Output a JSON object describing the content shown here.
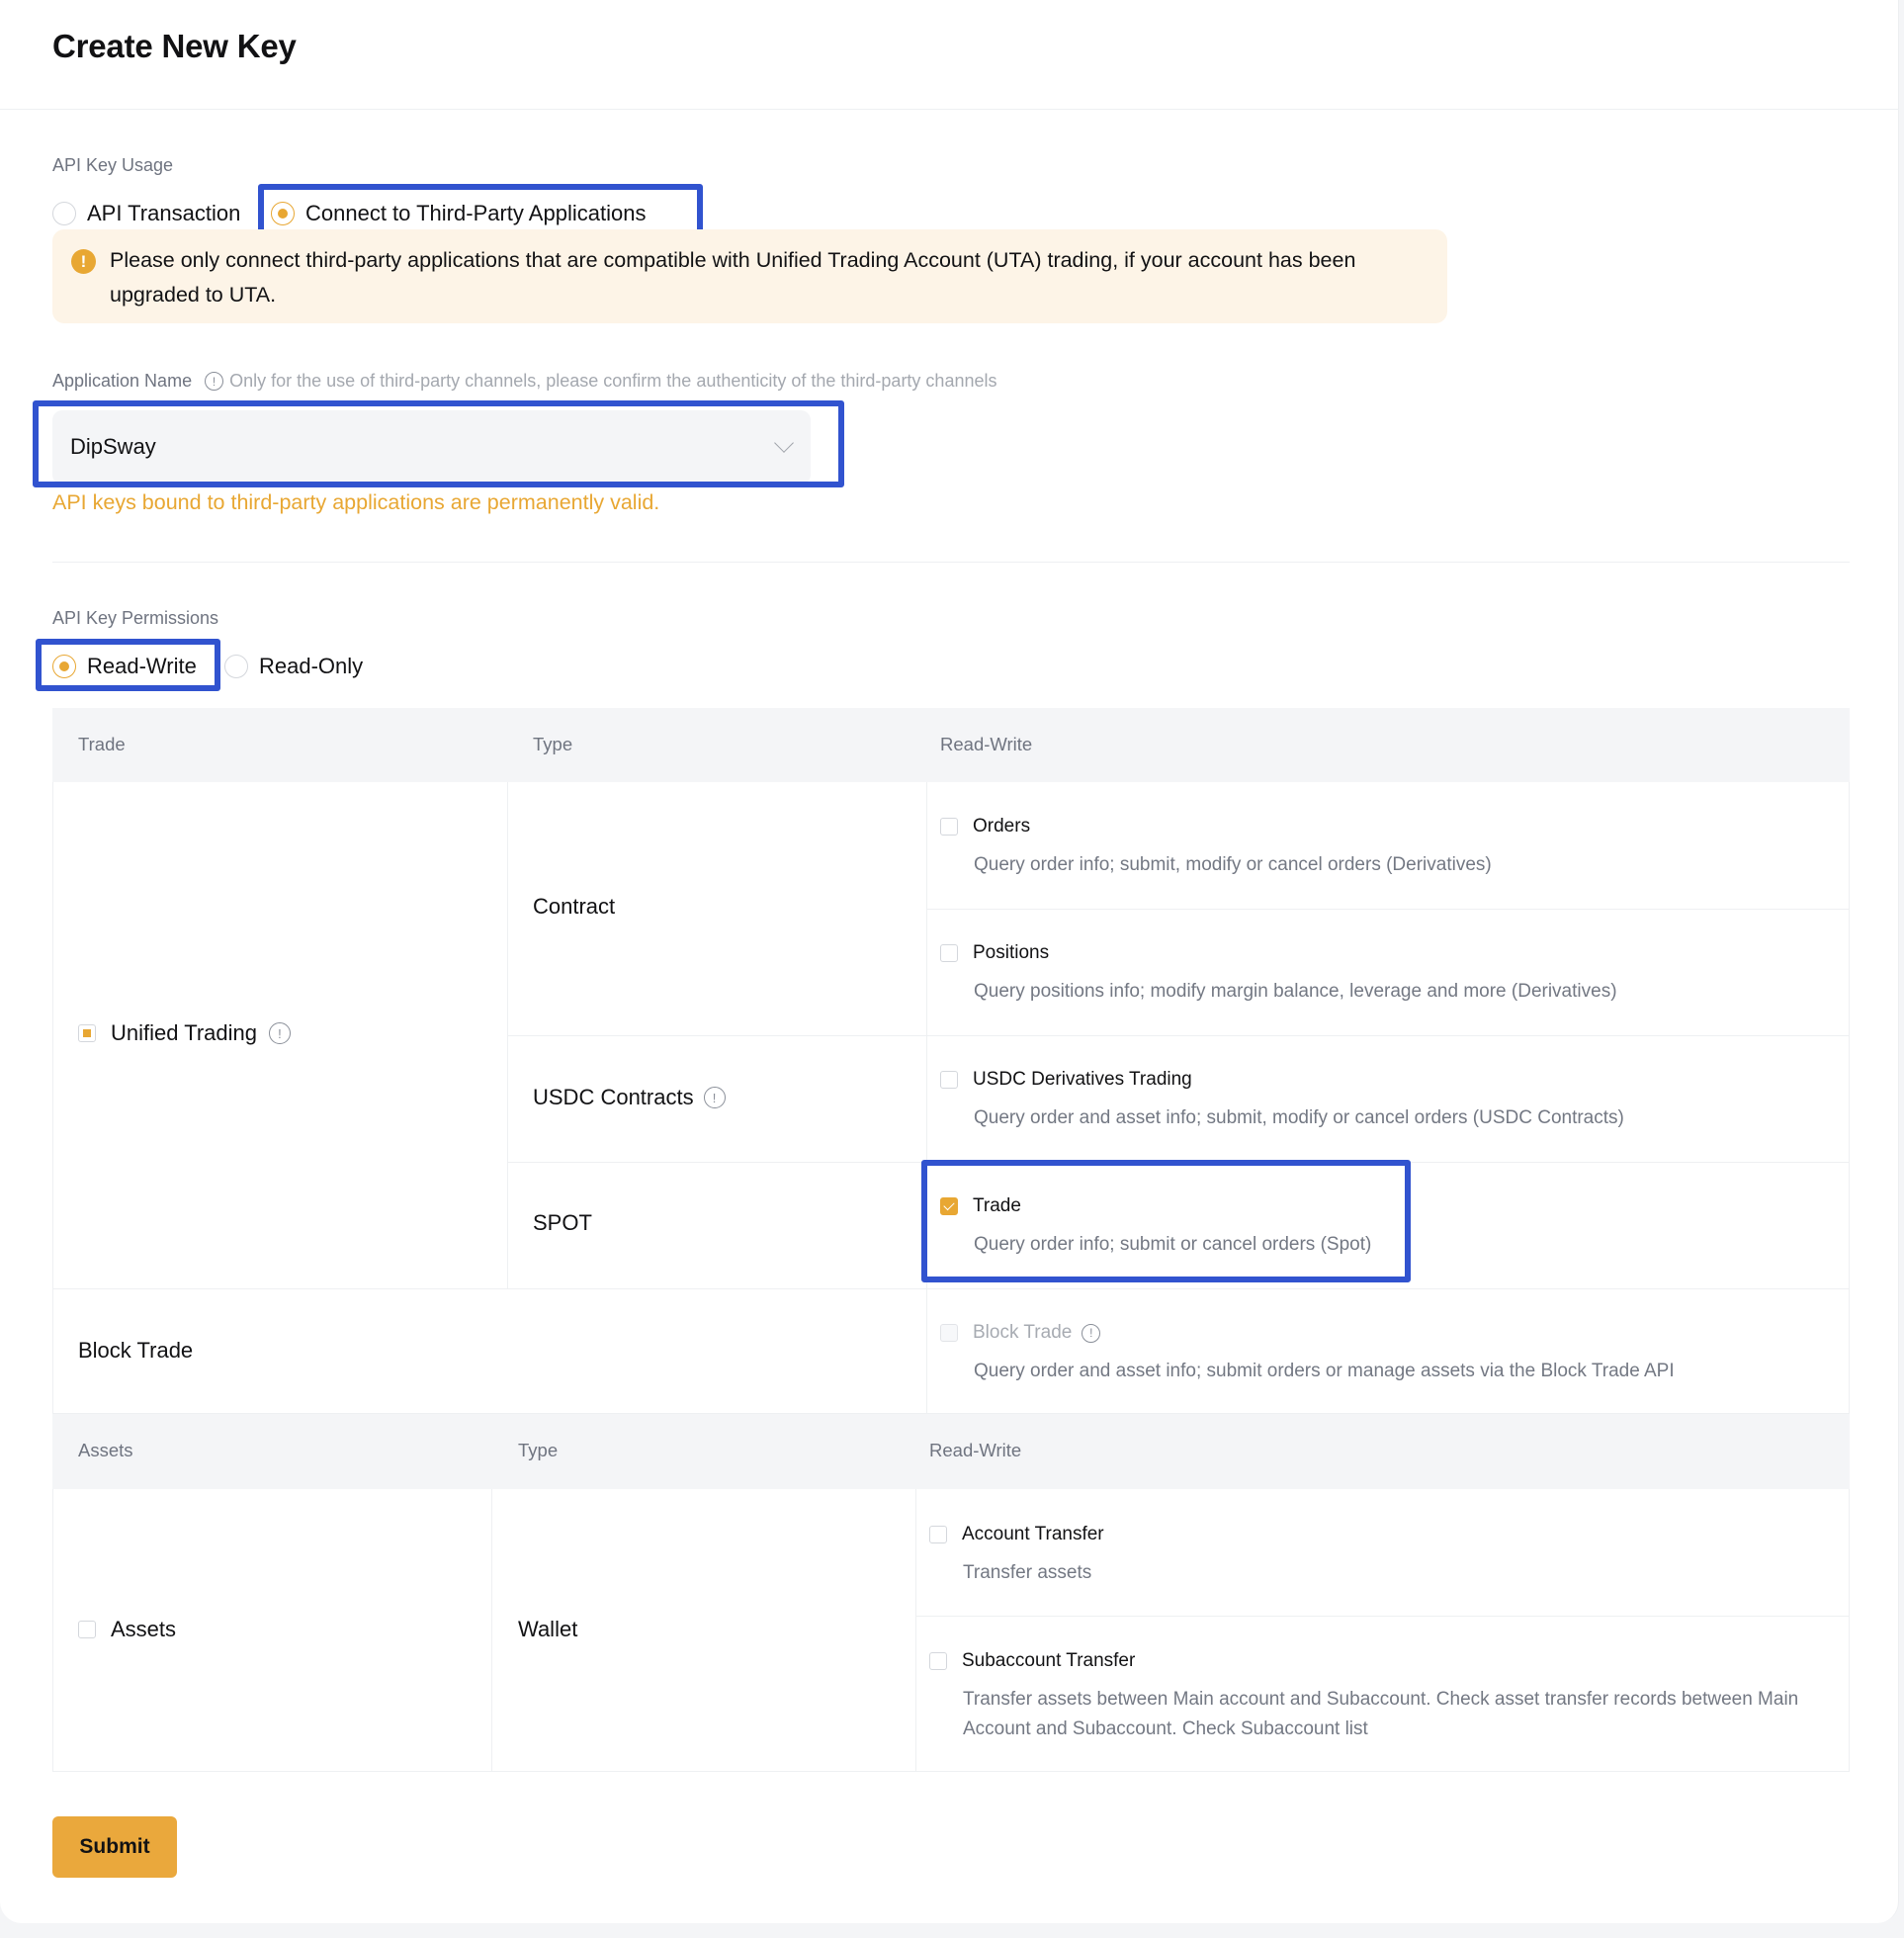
{
  "page": {
    "title": "Create New Key"
  },
  "usage": {
    "label": "API Key Usage",
    "options": [
      {
        "label": "API Transaction",
        "selected": false
      },
      {
        "label": "Connect to Third-Party Applications",
        "selected": true
      }
    ],
    "alert": {
      "icon": "warning-icon",
      "text": "Please only connect third-party applications that are compatible with Unified Trading Account (UTA) trading, if your account has been upgraded to UTA."
    }
  },
  "application": {
    "label": "Application Name",
    "hint": "Only for the use of third-party channels, please confirm the authenticity of the third-party channels",
    "selected_value": "DipSway",
    "note": "API keys bound to third-party applications are permanently valid."
  },
  "permissions": {
    "label": "API Key Permissions",
    "options": [
      {
        "label": "Read-Write",
        "selected": true
      },
      {
        "label": "Read-Only",
        "selected": false
      }
    ]
  },
  "trade_table": {
    "headers": [
      "Trade",
      "Type",
      "Read-Write"
    ],
    "unified_trading": {
      "label": "Unified Trading",
      "state": "partial"
    },
    "types": {
      "contract": "Contract",
      "usdc": "USDC Contracts",
      "spot": "SPOT"
    },
    "perms": {
      "orders": {
        "title": "Orders",
        "desc": "Query order info; submit, modify or cancel orders (Derivatives)",
        "checked": false
      },
      "positions": {
        "title": "Positions",
        "desc": "Query positions info; modify margin balance, leverage and more (Derivatives)",
        "checked": false
      },
      "usdc_trading": {
        "title": "USDC Derivatives Trading",
        "desc": "Query order and asset info; submit, modify or cancel orders (USDC Contracts)",
        "checked": false
      },
      "spot_trade": {
        "title": "Trade",
        "desc": "Query order info; submit or cancel orders (Spot)",
        "checked": true
      },
      "block_trade": {
        "title": "Block Trade",
        "desc": "Query order and asset info; submit orders or manage assets via the Block Trade API",
        "checked": false,
        "disabled": true
      }
    },
    "block_trade_label": "Block Trade"
  },
  "assets_table": {
    "headers": [
      "Assets",
      "Type",
      "Read-Write"
    ],
    "assets": {
      "label": "Assets",
      "checked": false
    },
    "type": "Wallet",
    "perms": {
      "account_transfer": {
        "title": "Account Transfer",
        "desc": "Transfer assets",
        "checked": false
      },
      "subaccount_transfer": {
        "title": "Subaccount Transfer",
        "desc": "Transfer assets between Main account and Subaccount. Check asset transfer records between Main Account and Subaccount. Check Subaccount list",
        "checked": false
      }
    }
  },
  "actions": {
    "submit_label": "Submit"
  },
  "colors": {
    "accent": "#e8a733",
    "highlight": "#3153cf",
    "alert_bg": "#fdf4e7"
  }
}
